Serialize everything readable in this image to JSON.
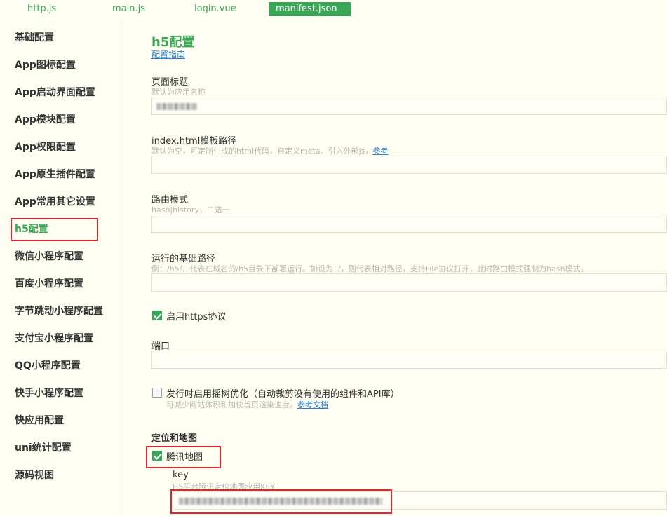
{
  "tabs": [
    {
      "label": "http.js"
    },
    {
      "label": "main.js"
    },
    {
      "label": "login.vue"
    },
    {
      "label": "manifest.json"
    }
  ],
  "sidebar": {
    "items": [
      {
        "label": "基础配置"
      },
      {
        "label": "App图标配置"
      },
      {
        "label": "App启动界面配置"
      },
      {
        "label": "App模块配置"
      },
      {
        "label": "App权限配置"
      },
      {
        "label": "App原生插件配置"
      },
      {
        "label": "App常用其它设置"
      },
      {
        "label": "h5配置"
      },
      {
        "label": "微信小程序配置"
      },
      {
        "label": "百度小程序配置"
      },
      {
        "label": "字节跳动小程序配置"
      },
      {
        "label": "支付宝小程序配置"
      },
      {
        "label": "QQ小程序配置"
      },
      {
        "label": "快手小程序配置"
      },
      {
        "label": "快应用配置"
      },
      {
        "label": "uni统计配置"
      },
      {
        "label": "源码视图"
      }
    ],
    "active": "h5配置"
  },
  "main": {
    "title": "h5配置",
    "guide_link": "配置指南",
    "page_title": {
      "label": "页面标题",
      "hint": "默认为应用名称"
    },
    "template": {
      "label": "index.html模板路径",
      "hint": "默认为空，可定制生成的html代码，自定义meta、引入外部js，",
      "link": "参考"
    },
    "router": {
      "label": "路由模式",
      "hint": "hash|history，二选一"
    },
    "base": {
      "label": "运行的基础路径",
      "hint": "例：/h5/，代表在域名的/h5目录下部署运行。如设为 ./，则代表相对路径，支持File协议打开，此时路由模式强制为hash模式。"
    },
    "https": {
      "label": "启用https协议",
      "checked": true
    },
    "port": {
      "label": "端口"
    },
    "treeshaking": {
      "label": "发行时启用摇树优化（自动裁剪没有使用的组件和API库）",
      "hint": "可减少网站体积和加快首页渲染速度。",
      "link": "参考文档",
      "checked": false
    },
    "map_section": "定位和地图",
    "tencent_map": {
      "label": "腾讯地图",
      "checked": true
    },
    "key": {
      "label": "key",
      "hint": "H5平台腾讯定位地图应用KEY"
    }
  },
  "colors": {
    "accent": "#3aa757",
    "highlight": "#e0262c",
    "link": "#2a7fd4",
    "background": "#fffef2"
  }
}
